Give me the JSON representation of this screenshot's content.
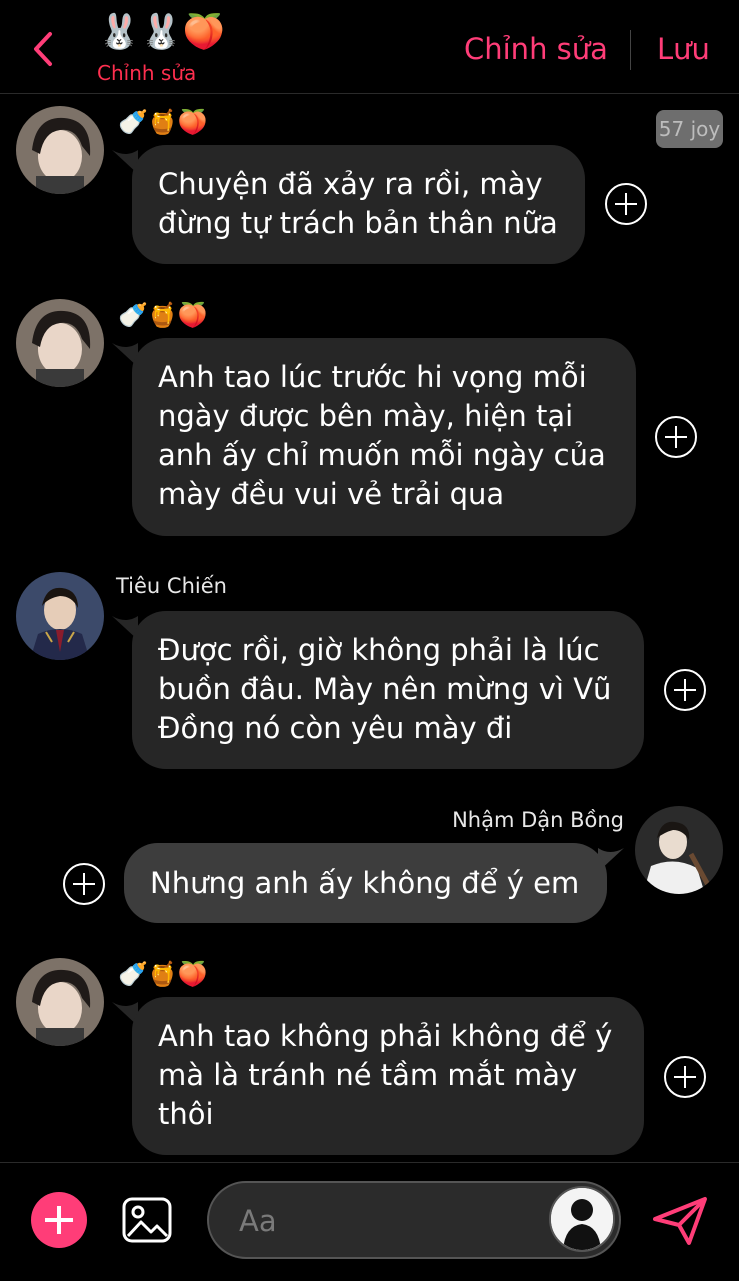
{
  "header": {
    "title_emojis": "🐰🐰🍑",
    "title_subtitle": "Chỉnh sửa",
    "edit_label": "Chỉnh sửa",
    "save_label": "Lưu",
    "back_icon": "chevron-left-icon",
    "accent_color": "#ff3d78"
  },
  "badge": "57 joy",
  "messages": [
    {
      "sender": "🍼🍯🍑",
      "sender_is_emoji": true,
      "text": "Chuyện đã xảy ra rồi, mày\nđừng tự trách bản thân nữa",
      "side": "left"
    },
    {
      "sender": "🍼🍯🍑",
      "sender_is_emoji": true,
      "text": "Anh tao lúc trước hi vọng mỗi\nngày được bên mày, hiện tại\nanh ấy chỉ muốn mỗi ngày của\nmày đều vui vẻ trải qua",
      "side": "left"
    },
    {
      "sender": "Tiêu Chiến",
      "text": "Được rồi, giờ không phải là lúc\nbuồn đâu. Mày nên mừng vì Vũ\nĐồng nó còn yêu mày đi",
      "side": "left"
    },
    {
      "sender": "Nhậm Dận Bồng",
      "text": "Nhưng anh ấy không để ý em",
      "side": "right"
    },
    {
      "sender": "🍼🍯🍑",
      "sender_is_emoji": true,
      "text": "Anh tao không phải không để ý\nmà là tránh né tầm mắt mày\nthôi",
      "side": "left"
    }
  ],
  "composer": {
    "placeholder": "Aa",
    "add_icon": "plus-icon",
    "image_icon": "image-icon",
    "send_icon": "send-icon"
  },
  "colors": {
    "bubble": "#262626",
    "background": "#000000",
    "accent": "#ff3d78"
  }
}
